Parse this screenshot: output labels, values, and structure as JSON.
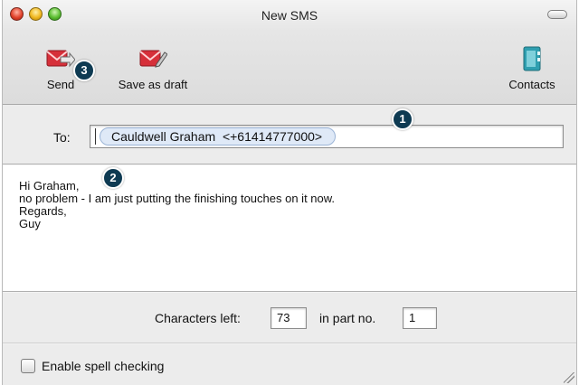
{
  "window": {
    "title": "New SMS"
  },
  "toolbar": {
    "send_label": "Send",
    "draft_label": "Save as draft",
    "contacts_label": "Contacts"
  },
  "message": {
    "to_label": "To:",
    "recipient": "Cauldwell Graham  <+61414777000>",
    "body_lines": [
      "Hi Graham,",
      "no problem - I am just putting the finishing touches on it now.",
      "Regards,",
      "Guy"
    ]
  },
  "status": {
    "chars_left_label": "Characters left:",
    "chars_left_value": "73",
    "part_label": "in part no.",
    "part_value": "1"
  },
  "options": {
    "spell_check_label": "Enable spell checking",
    "spell_check_checked": false
  },
  "callouts": {
    "recipient": "1",
    "body": "2",
    "send": "3"
  },
  "colors": {
    "callout_bg": "#0e3a52",
    "send_icon": "#d6303a",
    "contacts_icon": "#2f9fb0",
    "token_bg": "#dfe9f7"
  }
}
